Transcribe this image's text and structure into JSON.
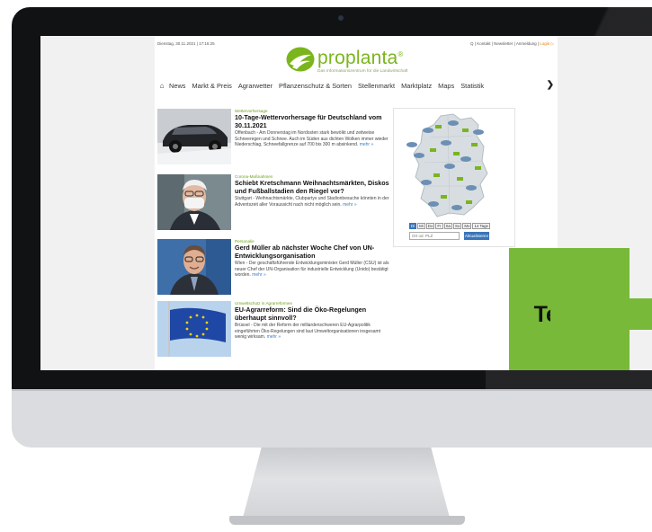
{
  "site": {
    "date_time": "Dienstag, 30.11.2021 | 17:16:25",
    "top_links": {
      "text": "Q | Kontakt | Newsletter | Anmeldung | ",
      "login": "Login ▷"
    },
    "logo_text": "proplanta",
    "logo_mark": "®",
    "tagline": "Das Informationszentrum für die Landwirtschaft"
  },
  "nav": {
    "home_icon": "home-icon",
    "items": [
      "News",
      "Markt & Preis",
      "Agrarwetter",
      "Pflanzenschutz & Sorten",
      "Stellenmarkt",
      "Marktplatz",
      "Maps",
      "Statistik"
    ],
    "next_icon": "chevron-right-icon"
  },
  "articles": [
    {
      "kicker": "Wettervorhersage",
      "headline": "10-Tage-Wettervorhersage für Deutschland vom 30.11.2021",
      "summary": "Offenbach - Am Donnerstag im Nordosten stark bewölkt und zeitweise Schneeregen und Schnee. Auch im Süden aus dichten Wolken immer wieder Niederschlag, Schneefallgrenze auf 700 bis 300 m absinkend.",
      "more": "mehr »"
    },
    {
      "kicker": "Corona-Maßnahmen",
      "headline": "Schiebt Kretschmann Weihnachtsmärkten, Diskos und Fußballstadien den Riegel vor?",
      "summary": "Stuttgart - Weihnachtsmärkte, Clubpartys und Stadionbesuche könnten in der Adventszeit aller Voraussicht nach nicht möglich sein.",
      "more": "mehr »"
    },
    {
      "kicker": "Personalie",
      "headline": "Gerd Müller ab nächster Woche Chef von UN-Entwicklungsorganisation",
      "summary": "Wien - Der geschäftsführende Entwicklungsminister Gerd Müller (CSU) ist als neuer Chef der UN-Organisation für industrielle Entwicklung (Unido) bestätigt worden.",
      "more": "mehr »"
    },
    {
      "kicker": "Umweltschutz in Agrarreformen",
      "headline": "EU-Agrarreform: Sind die Öko-Regelungen überhaupt sinnvoll?",
      "summary": "Brüssel - Die mit der Reform der milliardenschweren EU-Agrarpolitik eingeführten Öko-Regelungen sind laut Umweltorganisationen insgesamt wenig wirksam.",
      "more": "mehr »"
    }
  ],
  "weather_widget": {
    "days": [
      "Di",
      "Mi",
      "Do",
      "Fr",
      "Sa",
      "So",
      "Mo",
      "14 Tage"
    ],
    "selected_day": "Di",
    "plz_placeholder": "Ort od. PLZ",
    "button": "Aktualisieren"
  },
  "teaser": {
    "label": "Teaser",
    "color": "#79b93a"
  },
  "colors": {
    "brand_green": "#7ab51d",
    "link_blue": "#3c7cc4",
    "bezel": "#111214"
  }
}
